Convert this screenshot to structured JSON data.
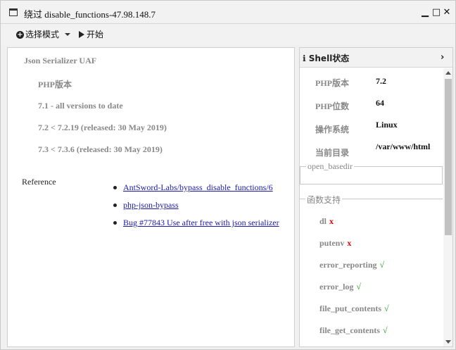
{
  "window": {
    "title": "绕过 disable_functions-47.98.148.7",
    "minimize_glyph": "▁",
    "maximize_glyph": "□",
    "close_glyph": "✕"
  },
  "toolbar": {
    "mode_label": "选择模式",
    "start_label": "开始"
  },
  "main": {
    "vuln_title": "Json Serializer UAF",
    "php_version_label": "PHP版本",
    "versions": [
      "7.1 - all versions to date",
      "7.2 < 7.2.19 (released: 30 May 2019)",
      "7.3 < 7.3.6 (released: 30 May 2019)"
    ],
    "reference_label": "Reference",
    "references": [
      "AntSword-Labs/bypass_disable_functions/6",
      "php-json-bypass",
      "Bug #77843 Use after free with json serializer"
    ]
  },
  "shell_panel": {
    "title": "Shell状态",
    "info_icon": "ℹ",
    "chevron": "›",
    "info": [
      {
        "key": "PHP版本",
        "value": "7.2"
      },
      {
        "key": "PHP位数",
        "value": "64"
      },
      {
        "key": "操作系统",
        "value": "Linux"
      },
      {
        "key": "当前目录",
        "value": "/var/www/html"
      }
    ],
    "open_basedir_legend": "open_basedir",
    "functions_legend": "函数支持",
    "functions": [
      {
        "name": "dl",
        "mark": "x",
        "supported": false
      },
      {
        "name": "putenv",
        "mark": "x",
        "supported": false
      },
      {
        "name": "error_reporting",
        "mark": "√",
        "supported": true
      },
      {
        "name": "error_log",
        "mark": "√",
        "supported": true
      },
      {
        "name": "file_put_contents",
        "mark": "√",
        "supported": true
      },
      {
        "name": "file_get_contents",
        "mark": "√",
        "supported": true
      }
    ]
  },
  "colors": {
    "link": "#1a1aa6",
    "unsupported": "#dd0000",
    "supported": "#2a9a2a",
    "muted_label": "#888888"
  }
}
